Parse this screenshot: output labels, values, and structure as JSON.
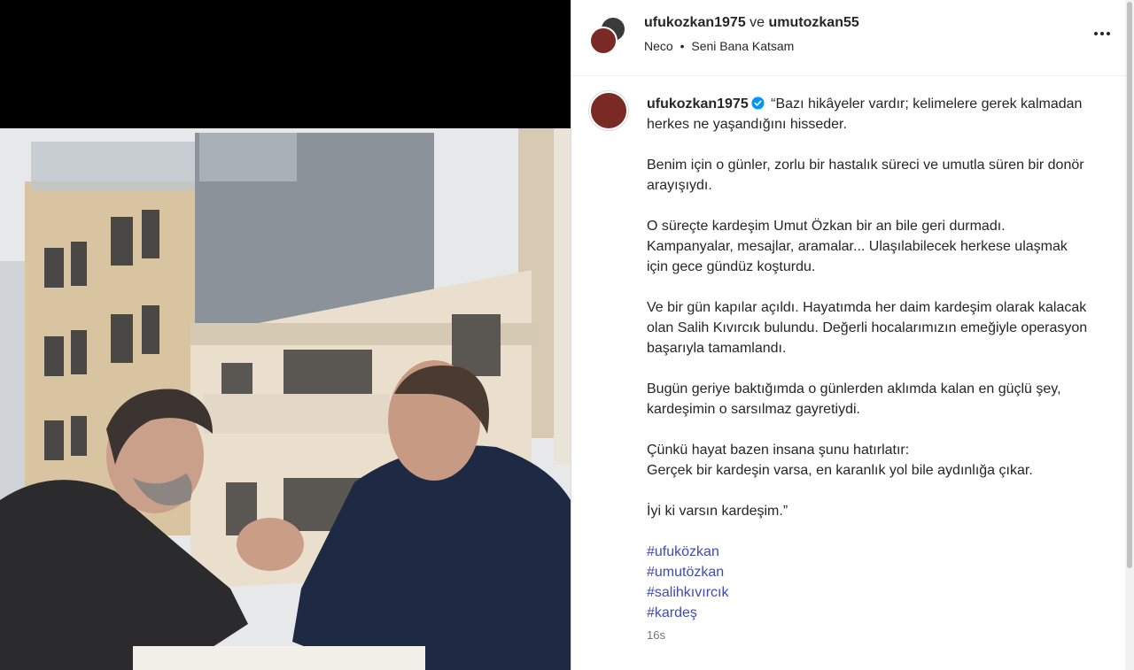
{
  "post": {
    "authors": {
      "primary": "ufukozkan1975",
      "joiner": "ve",
      "secondary": "umutozkan55"
    },
    "audio": {
      "artist": "Neco",
      "separator": "•",
      "song": "Seni Bana Katsam"
    },
    "more_icon": "more-horizontal-icon"
  },
  "caption": {
    "username": "ufukozkan1975",
    "verified_icon": "verified-badge-icon",
    "paragraphs": [
      "“Bazı hikâyeler vardır; kelimelere gerek kalmadan herkes ne yaşandığını hisseder.",
      "Benim için o günler, zorlu bir hastalık süreci ve umutla süren bir donör arayışıydı.",
      "O süreçte kardeşim Umut Özkan bir an bile geri durmadı. Kampanyalar, mesajlar, aramalar... Ulaşılabilecek herkese ulaşmak için gece gündüz koşturdu.",
      "Ve bir gün kapılar açıldı. Hayatımda her daim kardeşim olarak kalacak olan Salih Kıvırcık bulundu. Değerli hocalarımızın emeğiyle operasyon başarıyla tamamlandı.",
      "Bugün geriye baktığımda o günlerden aklımda kalan en güçlü şey, kardeşimin o sarsılmaz gayretiydi.",
      "Çünkü hayat bazen insana şunu hatırlatır:",
      "Gerçek bir kardeşin varsa, en karanlık yol bile aydınlığa çıkar.",
      "İyi ki varsın kardeşim.”"
    ],
    "hashtags": [
      "#ufuközkan",
      "#umutözkan",
      "#salihkıvırcık",
      "#kardeş"
    ],
    "timestamp": "16s"
  },
  "colors": {
    "hashtag": "#3d4bb8",
    "verified": "#0095f6",
    "muted": "#737373"
  }
}
